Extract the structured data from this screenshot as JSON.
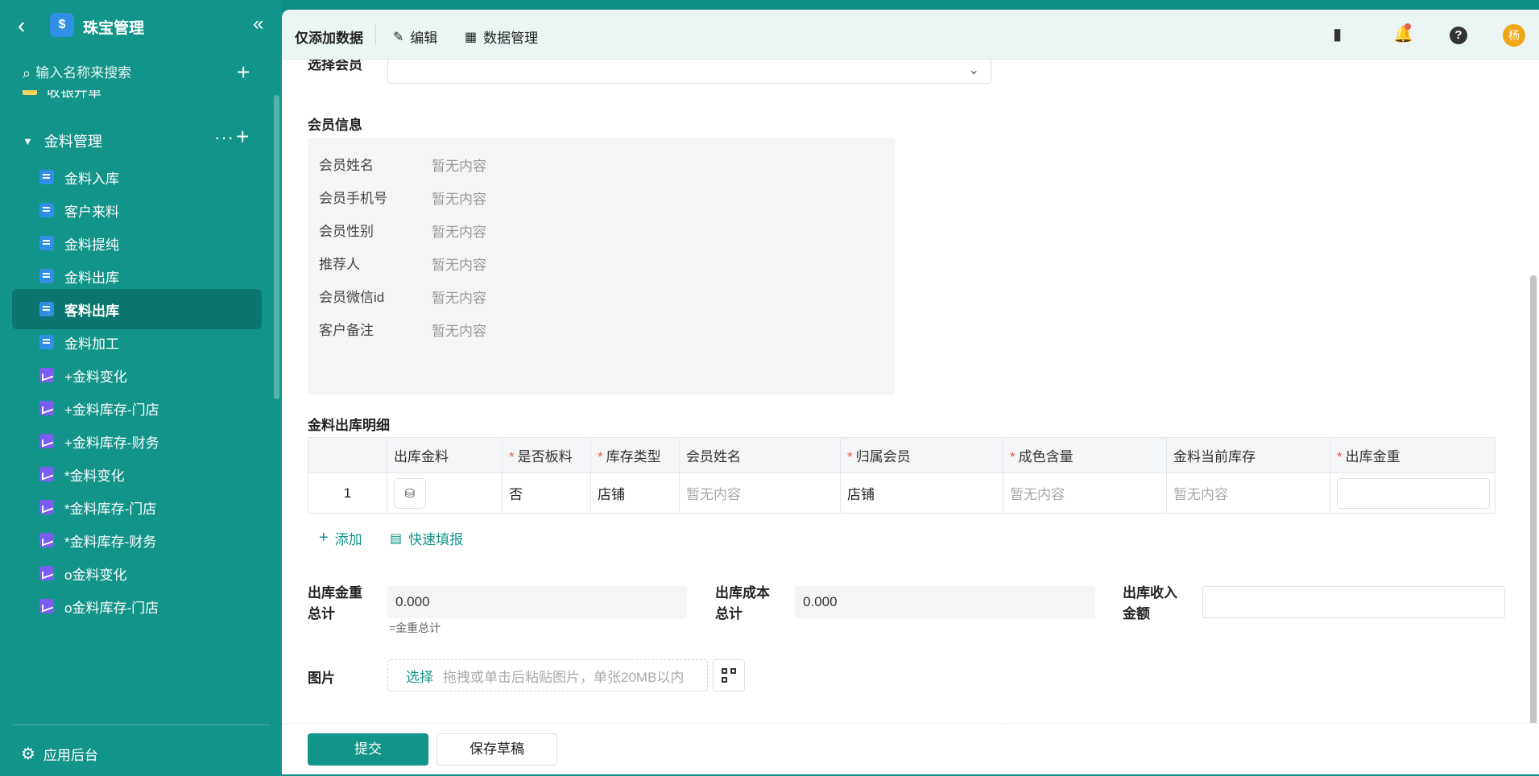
{
  "sidebar": {
    "app_title": "珠宝管理",
    "app_icon": "$",
    "search_placeholder": "输入名称来搜索",
    "partial_item": "收银开单",
    "group_label": "金料管理",
    "items": [
      {
        "label": "金料入库",
        "icon": "form-icon"
      },
      {
        "label": "客户来料",
        "icon": "form-icon"
      },
      {
        "label": "金料提纯",
        "icon": "form-icon"
      },
      {
        "label": "金料出库",
        "icon": "form-icon"
      },
      {
        "label": "客料出库",
        "icon": "form-icon",
        "active": true
      },
      {
        "label": "金料加工",
        "icon": "form-icon"
      },
      {
        "label": "+金料变化",
        "icon": "report-icon"
      },
      {
        "label": "+金料库存-门店",
        "icon": "report-icon"
      },
      {
        "label": "+金料库存-财务",
        "icon": "report-icon"
      },
      {
        "label": "*金料变化",
        "icon": "report-icon"
      },
      {
        "label": "*金料库存-门店",
        "icon": "report-icon"
      },
      {
        "label": "*金料库存-财务",
        "icon": "report-icon"
      },
      {
        "label": "o金料变化",
        "icon": "report-icon"
      },
      {
        "label": "o金料库存-门店",
        "icon": "report-icon"
      }
    ],
    "footer_label": "应用后台"
  },
  "topbar": {
    "title": "仅添加数据",
    "edit_label": "编辑",
    "data_manage_label": "数据管理",
    "avatar_text": "杨"
  },
  "form": {
    "select_member_label": "选择会员",
    "member_info_label": "会员信息",
    "member_fields": [
      {
        "label": "会员姓名",
        "value": "暂无内容"
      },
      {
        "label": "会员手机号",
        "value": "暂无内容"
      },
      {
        "label": "会员性别",
        "value": "暂无内容"
      },
      {
        "label": "推荐人",
        "value": "暂无内容"
      },
      {
        "label": "会员微信id",
        "value": "暂无内容"
      },
      {
        "label": "客户备注",
        "value": "暂无内容"
      }
    ],
    "detail_label": "金料出库明细",
    "table": {
      "headers": [
        "",
        "出库金料",
        "是否板料",
        "库存类型",
        "会员姓名",
        "归属会员",
        "成色含量",
        "金料当前库存",
        "出库金重"
      ],
      "row": {
        "index": "1",
        "is_board": "否",
        "stock_type": "店铺",
        "member_name": "暂无内容",
        "owner_member": "店铺",
        "purity": "暂无内容",
        "current_stock": "暂无内容"
      }
    },
    "add_label": "添加",
    "quick_fill_label": "快速填报",
    "total_weight_label_1": "出库金重",
    "total_weight_label_2": "总计",
    "total_weight_value": "0.000",
    "total_weight_note": "=金重总计",
    "total_cost_label_1": "出库成本",
    "total_cost_label_2": "总计",
    "total_cost_value": "0.000",
    "income_label_1": "出库收入",
    "income_label_2": "金额",
    "image_label": "图片",
    "upload_select": "选择",
    "upload_hint": "拖拽或单击后粘贴图片，单张20MB以内"
  },
  "footer": {
    "submit_label": "提交",
    "draft_label": "保存草稿"
  }
}
